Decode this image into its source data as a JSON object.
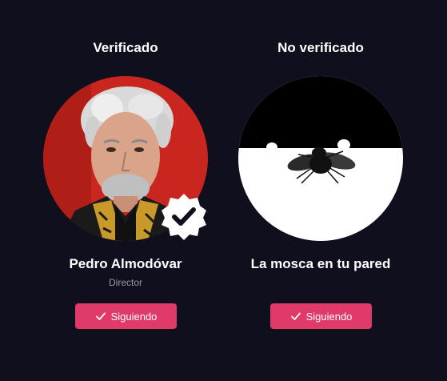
{
  "verified_card": {
    "heading": "Verificado",
    "name": "Pedro Almodóvar",
    "role": "Director",
    "button_label": "Siguiendo",
    "avatar_icon": "person-portrait",
    "badge_icon": "verified-check-badge"
  },
  "unverified_card": {
    "heading": "No verificado",
    "name": "La mosca en tu pared",
    "button_label": "Siguiendo",
    "avatar_icon": "fly-on-wall"
  },
  "colors": {
    "background": "#0f0f1e",
    "accent": "#e03a68",
    "portrait_background": "#c8261f",
    "secondary_text": "#9a9aa6"
  }
}
